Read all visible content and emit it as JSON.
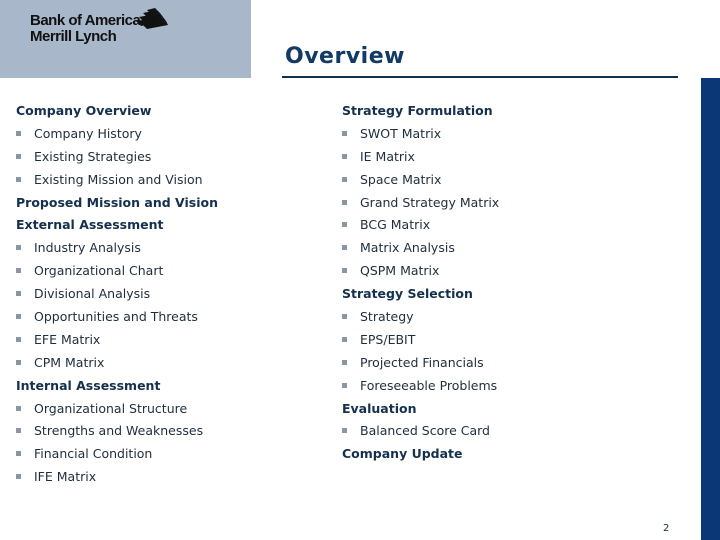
{
  "header": {
    "logo_line1": "Bank of America",
    "logo_line2": "Merrill Lynch",
    "logo_icon": "flag-logo-icon",
    "title": "Overview"
  },
  "colors": {
    "logo_bg": "#a8b7ca",
    "title": "#123a66",
    "side_bar": "#0b3776"
  },
  "left_column": [
    {
      "type": "heading",
      "text": "Company Overview"
    },
    {
      "type": "item",
      "text": "Company History"
    },
    {
      "type": "item",
      "text": "Existing Strategies"
    },
    {
      "type": "item",
      "text": "Existing Mission and Vision"
    },
    {
      "type": "heading",
      "text": "Proposed Mission and Vision"
    },
    {
      "type": "heading",
      "text": "External Assessment"
    },
    {
      "type": "item",
      "text": "Industry Analysis"
    },
    {
      "type": "item",
      "text": "Organizational Chart"
    },
    {
      "type": "item",
      "text": "Divisional Analysis"
    },
    {
      "type": "item",
      "text": "Opportunities and Threats"
    },
    {
      "type": "item",
      "text": "EFE Matrix"
    },
    {
      "type": "item",
      "text": "CPM Matrix"
    },
    {
      "type": "heading",
      "text": "Internal Assessment"
    },
    {
      "type": "item",
      "text": "Organizational Structure"
    },
    {
      "type": "item",
      "text": "Strengths and Weaknesses"
    },
    {
      "type": "item",
      "text": "Financial Condition"
    },
    {
      "type": "item",
      "text": "IFE Matrix"
    }
  ],
  "right_column": [
    {
      "type": "heading",
      "text": "Strategy Formulation"
    },
    {
      "type": "item",
      "text": "SWOT Matrix"
    },
    {
      "type": "item",
      "text": "IE Matrix"
    },
    {
      "type": "item",
      "text": "Space Matrix"
    },
    {
      "type": "item",
      "text": "Grand Strategy Matrix"
    },
    {
      "type": "item",
      "text": "BCG Matrix"
    },
    {
      "type": "item",
      "text": "Matrix Analysis"
    },
    {
      "type": "item",
      "text": "QSPM Matrix"
    },
    {
      "type": "heading",
      "text": "Strategy Selection"
    },
    {
      "type": "item",
      "text": "Strategy"
    },
    {
      "type": "item",
      "text": "EPS/EBIT"
    },
    {
      "type": "item",
      "text": "Projected Financials"
    },
    {
      "type": "item",
      "text": "Foreseeable Problems"
    },
    {
      "type": "heading",
      "text": "Evaluation"
    },
    {
      "type": "item",
      "text": "Balanced Score Card"
    },
    {
      "type": "heading",
      "text": "Company Update"
    }
  ],
  "footer": {
    "page_number": "2"
  }
}
